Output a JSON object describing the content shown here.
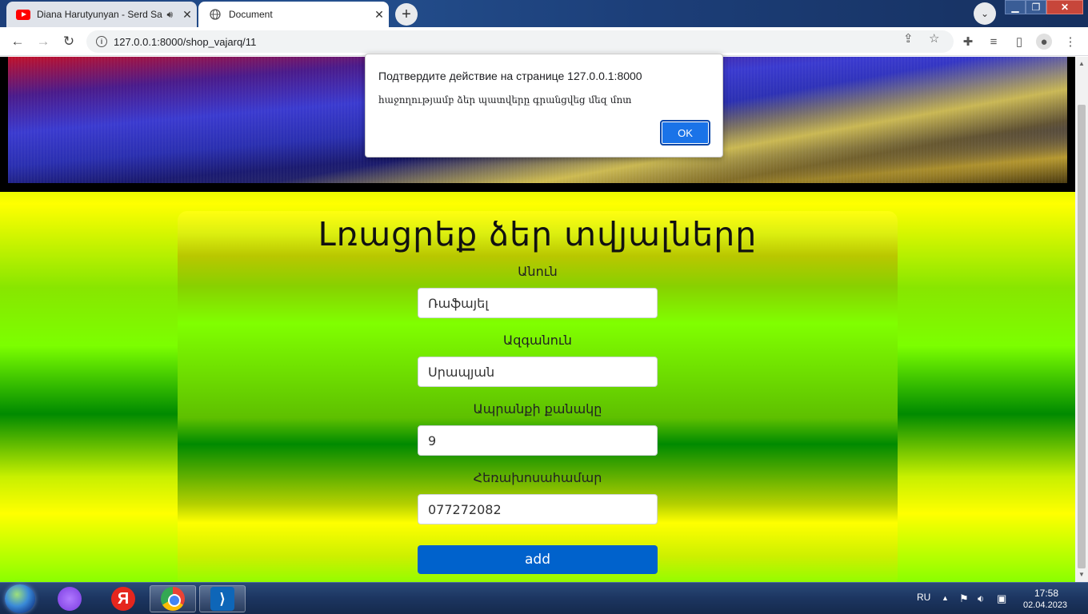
{
  "browser": {
    "tabs": [
      {
        "title": "Diana Harutyunyan - Serd Sa",
        "icon": "youtube-icon",
        "audio": true
      },
      {
        "title": "Document",
        "icon": "globe-icon"
      }
    ],
    "url": "127.0.0.1:8000/shop_vajarq/11"
  },
  "dialog": {
    "title": "Подтвердите действие на странице 127.0.0.1:8000",
    "message": "հաջողությամբ ձեր պատվերը գրանցվեց մեզ մոտ",
    "ok_label": "OK"
  },
  "form": {
    "title": "Լռացրեք ձեր տվյալները",
    "fields": [
      {
        "label": "Անուն",
        "value": "Ռաֆայել"
      },
      {
        "label": "Ազգանուն",
        "value": "Սրապյան"
      },
      {
        "label": "Ապրանքի քանակը",
        "value": "9"
      },
      {
        "label": "Հեռախոսահամար",
        "value": "077272082"
      }
    ],
    "submit_label": "add"
  },
  "taskbar": {
    "language": "RU",
    "time": "17:58",
    "date": "02.04.2023"
  }
}
